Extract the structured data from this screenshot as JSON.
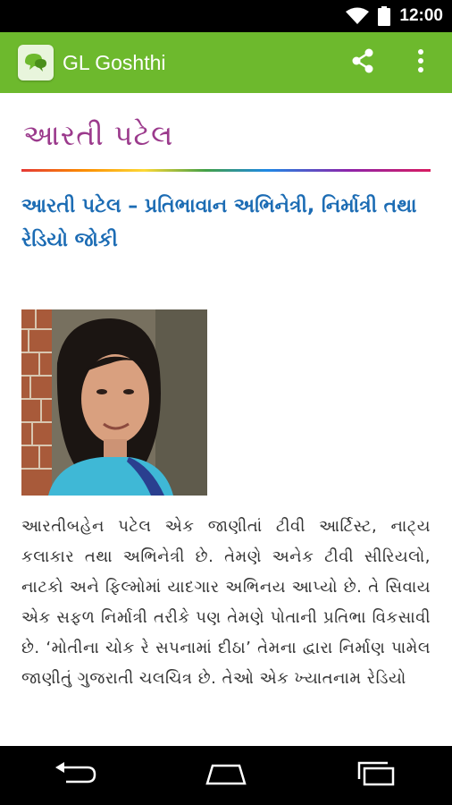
{
  "status_bar": {
    "time": "12:00"
  },
  "app_bar": {
    "title": "GL Goshthi",
    "brand_color": "#6db92d"
  },
  "article": {
    "title": "આરતી પટેલ",
    "subtitle": "આરતી પટેલ – પ્રતિભાવાન અભિનેત્રી, નિર્માત્રી તથા રેડિયો જોકી",
    "body": "આરતીબહેન પટેલ એક જાણીતાં ટીવી આર્ટિસ્ટ, નાટ્ય કલાકાર તથા અભિનેત્રી છે. તેમણે અનેક ટીવી સીરિયલો, નાટકો અને ફિલ્મોમાં યાદગાર અભિનય આપ્યો છે. તે સિવાય એક સફળ નિર્માત્રી તરીકે પણ તેમણે પોતાની પ્રતિભા વિકસાવી છે. ‘મોતીના ચોક રે સપનામાં દીઠા’ તેમના દ્વારા નિર્માણ પામેલ જાણીતું ગુજરાતી ચલચિત્ર છે. તેઓ એક ખ્યાતનામ રેડિયો",
    "title_color": "#9b3a8c",
    "subtitle_color": "#1c6cb4"
  },
  "icons": {
    "share": "share-icon",
    "overflow": "more-vert-icon",
    "back": "back-icon",
    "home": "home-icon",
    "recents": "recents-icon"
  }
}
